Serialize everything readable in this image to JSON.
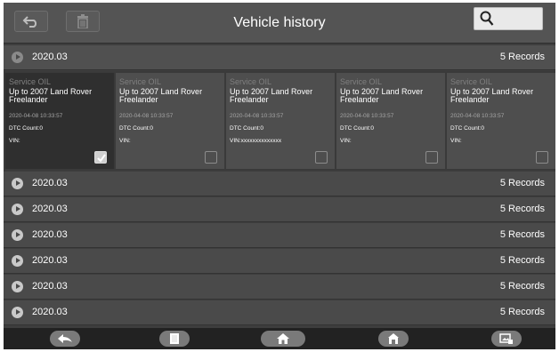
{
  "header": {
    "title": "Vehicle history",
    "search_placeholder": ""
  },
  "groups": [
    {
      "date": "2020.03",
      "count": "5 Records",
      "expanded": true
    },
    {
      "date": "2020.03",
      "count": "5 Records"
    },
    {
      "date": "2020.03",
      "count": "5 Records"
    },
    {
      "date": "2020.03",
      "count": "5 Records"
    },
    {
      "date": "2020.03",
      "count": "5 Records"
    },
    {
      "date": "2020.03",
      "count": "5 Records"
    },
    {
      "date": "2020.03",
      "count": "5 Records"
    }
  ],
  "cards": [
    {
      "title": "Service OIL",
      "vehicle": "Up to 2007 Land Rover Freelander",
      "date": "2020-04-08 10:33:57",
      "dtc": "DTC Count:0",
      "vin": "VIN:",
      "checked": true
    },
    {
      "title": "Service OIL",
      "vehicle": "Up to 2007 Land Rover Freelander",
      "date": "2020-04-08 10:33:57",
      "dtc": "DTC Count:0",
      "vin": "VIN:",
      "checked": false
    },
    {
      "title": "Service OIL",
      "vehicle": "Up to 2007 Land Rover Freelander",
      "date": "2020-04-08 10:33:57",
      "dtc": "DTC Count:0",
      "vin": "VIN:xxxxxxxxxxxxxx",
      "checked": false
    },
    {
      "title": "Service OIL",
      "vehicle": "Up to 2007 Land Rover Freelander",
      "date": "2020-04-08 10:33:57",
      "dtc": "DTC Count:0",
      "vin": "VIN:",
      "checked": false
    },
    {
      "title": "Service OIL",
      "vehicle": "Up to 2007 Land Rover Freelander",
      "date": "2020-04-08 10:33:57",
      "dtc": "DTC Count:0",
      "vin": "VIN:",
      "checked": false
    }
  ],
  "toolbar": {
    "icons": [
      "back-arrow-icon",
      "trash-icon",
      "search-icon"
    ]
  },
  "bottom_nav": {
    "icons": [
      "back-icon",
      "recent-apps-icon",
      "home-icon",
      "vci-home-icon",
      "screenshot-icon"
    ]
  },
  "colors": {
    "background": "#3e3e3e",
    "header_bar": "#545454",
    "selected_card": "#2f2f2f",
    "card": "#4e4e4e",
    "muted_text": "#7f7f7f",
    "bottom_bar": "#222222"
  }
}
